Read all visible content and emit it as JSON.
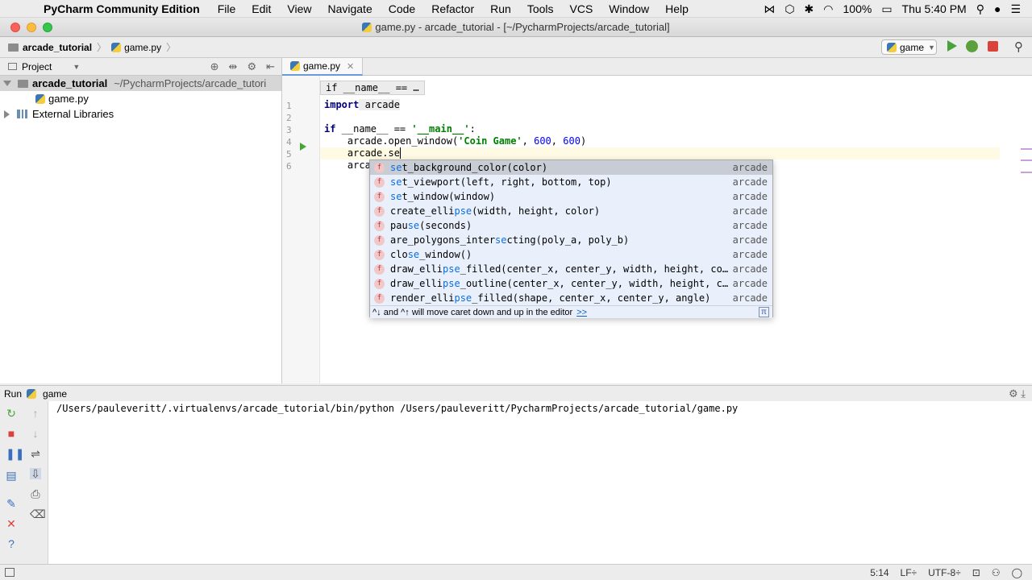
{
  "menubar": {
    "app_name": "PyCharm Community Edition",
    "menus": [
      "File",
      "Edit",
      "View",
      "Navigate",
      "Code",
      "Refactor",
      "Run",
      "Tools",
      "VCS",
      "Window",
      "Help"
    ],
    "battery": "100%",
    "clock": "Thu 5:40 PM"
  },
  "window": {
    "title": "game.py - arcade_tutorial - [~/PycharmProjects/arcade_tutorial]"
  },
  "navbar": {
    "project": "arcade_tutorial",
    "file": "game.py",
    "run_config": "game"
  },
  "project_panel": {
    "title": "Project",
    "root_name": "arcade_tutorial",
    "root_path": "~/PycharmProjects/arcade_tutori",
    "file": "game.py",
    "external": "External Libraries"
  },
  "editor": {
    "tab": "game.py",
    "breadcrumb_hint": "if __name__ == …",
    "lines": [
      "1",
      "2",
      "3",
      "4",
      "5",
      "6"
    ],
    "code": {
      "l1_kw": "import",
      "l1_rest": " arcade",
      "l3_kw": "if",
      "l3_mid": " __name__ == ",
      "l3_str": "'__main__'",
      "l3_end": ":",
      "l4_a": "    arcade.open_window(",
      "l4_str": "'Coin Game'",
      "l4_b": ", ",
      "l4_n1": "600",
      "l4_c": ", ",
      "l4_n2": "600",
      "l4_d": ")",
      "l5": "    arcade.se",
      "l6": "    arca"
    }
  },
  "completion": {
    "items": [
      {
        "pre": "",
        "match": "se",
        "rest": "t_background_color(color)",
        "module": "arcade"
      },
      {
        "pre": "",
        "match": "se",
        "rest": "t_viewport(left, right, bottom, top)",
        "module": "arcade"
      },
      {
        "pre": "",
        "match": "se",
        "rest": "t_window(window)",
        "module": "arcade"
      },
      {
        "pre": "create_elli",
        "match": "pse",
        "rest": "(width, height, color)",
        "module": "arcade"
      },
      {
        "pre": "pau",
        "match": "se",
        "rest": "(seconds)",
        "module": "arcade"
      },
      {
        "pre": "are_polygons_inter",
        "match": "se",
        "rest": "cting(poly_a, poly_b)",
        "module": "arcade"
      },
      {
        "pre": "clo",
        "match": "se",
        "rest": "_window()",
        "module": "arcade"
      },
      {
        "pre": "draw_elli",
        "match": "pse",
        "rest": "_filled(center_x, center_y, width, height, co…",
        "module": "arcade"
      },
      {
        "pre": "draw_elli",
        "match": "pse",
        "rest": "_outline(center_x, center_y, width, height, c…",
        "module": "arcade"
      },
      {
        "pre": "render_elli",
        "match": "pse",
        "rest": "_filled(shape, center_x, center_y, angle)",
        "module": "arcade"
      }
    ],
    "hint": "^↓ and ^↑ will move caret down and up in the editor",
    "hint_link": ">>",
    "pi": "π"
  },
  "run_panel": {
    "label": "Run",
    "config": "game",
    "console_line": "/Users/pauleveritt/.virtualenvs/arcade_tutorial/bin/python /Users/pauleveritt/PycharmProjects/arcade_tutorial/game.py"
  },
  "status": {
    "position": "5:14",
    "line_sep": "LF÷",
    "encoding": "UTF-8÷"
  }
}
